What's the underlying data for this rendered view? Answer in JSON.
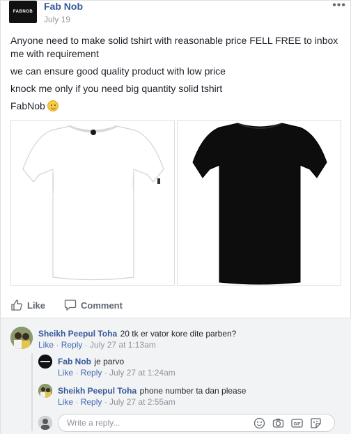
{
  "post": {
    "author": "Fab Nob",
    "avatar_label": "FABNOB",
    "date": "July 19",
    "more_label": "•••",
    "lines": [
      "Anyone need to make solid tshirt with reasonable price FELL FREE to inbox me with requirement",
      "we can ensure good quality product with low price",
      "knock me only if you need big quantity solid tshirt",
      "FabNob"
    ],
    "photos": [
      {
        "name": "white-tshirt",
        "color": "#ffffff"
      },
      {
        "name": "black-tshirt",
        "color": "#0d0d0d"
      }
    ]
  },
  "actions": {
    "like_label": "Like",
    "comment_label": "Comment"
  },
  "comments": {
    "main": {
      "author": "Sheikh Peepul Toha",
      "text": "20 tk er vator kore dite parben?",
      "like": "Like",
      "reply": "Reply",
      "time": "July 27 at 1:13am"
    },
    "replies": [
      {
        "author": "Fab Nob",
        "text": "je parvo",
        "like": "Like",
        "reply": "Reply",
        "time": "July 27 at 1:24am"
      },
      {
        "author": "Sheikh Peepul Toha",
        "text": "phone number ta dan please",
        "like": "Like",
        "reply": "Reply",
        "time": "July 27 at 2:55am"
      }
    ],
    "reply_placeholder": "Write a reply...",
    "reply_icons": [
      "emoji-icon",
      "camera-icon",
      "gif-icon",
      "sticker-icon"
    ]
  },
  "colors": {
    "link": "#365899",
    "meta": "#90949c",
    "accent": "#4267b2"
  }
}
